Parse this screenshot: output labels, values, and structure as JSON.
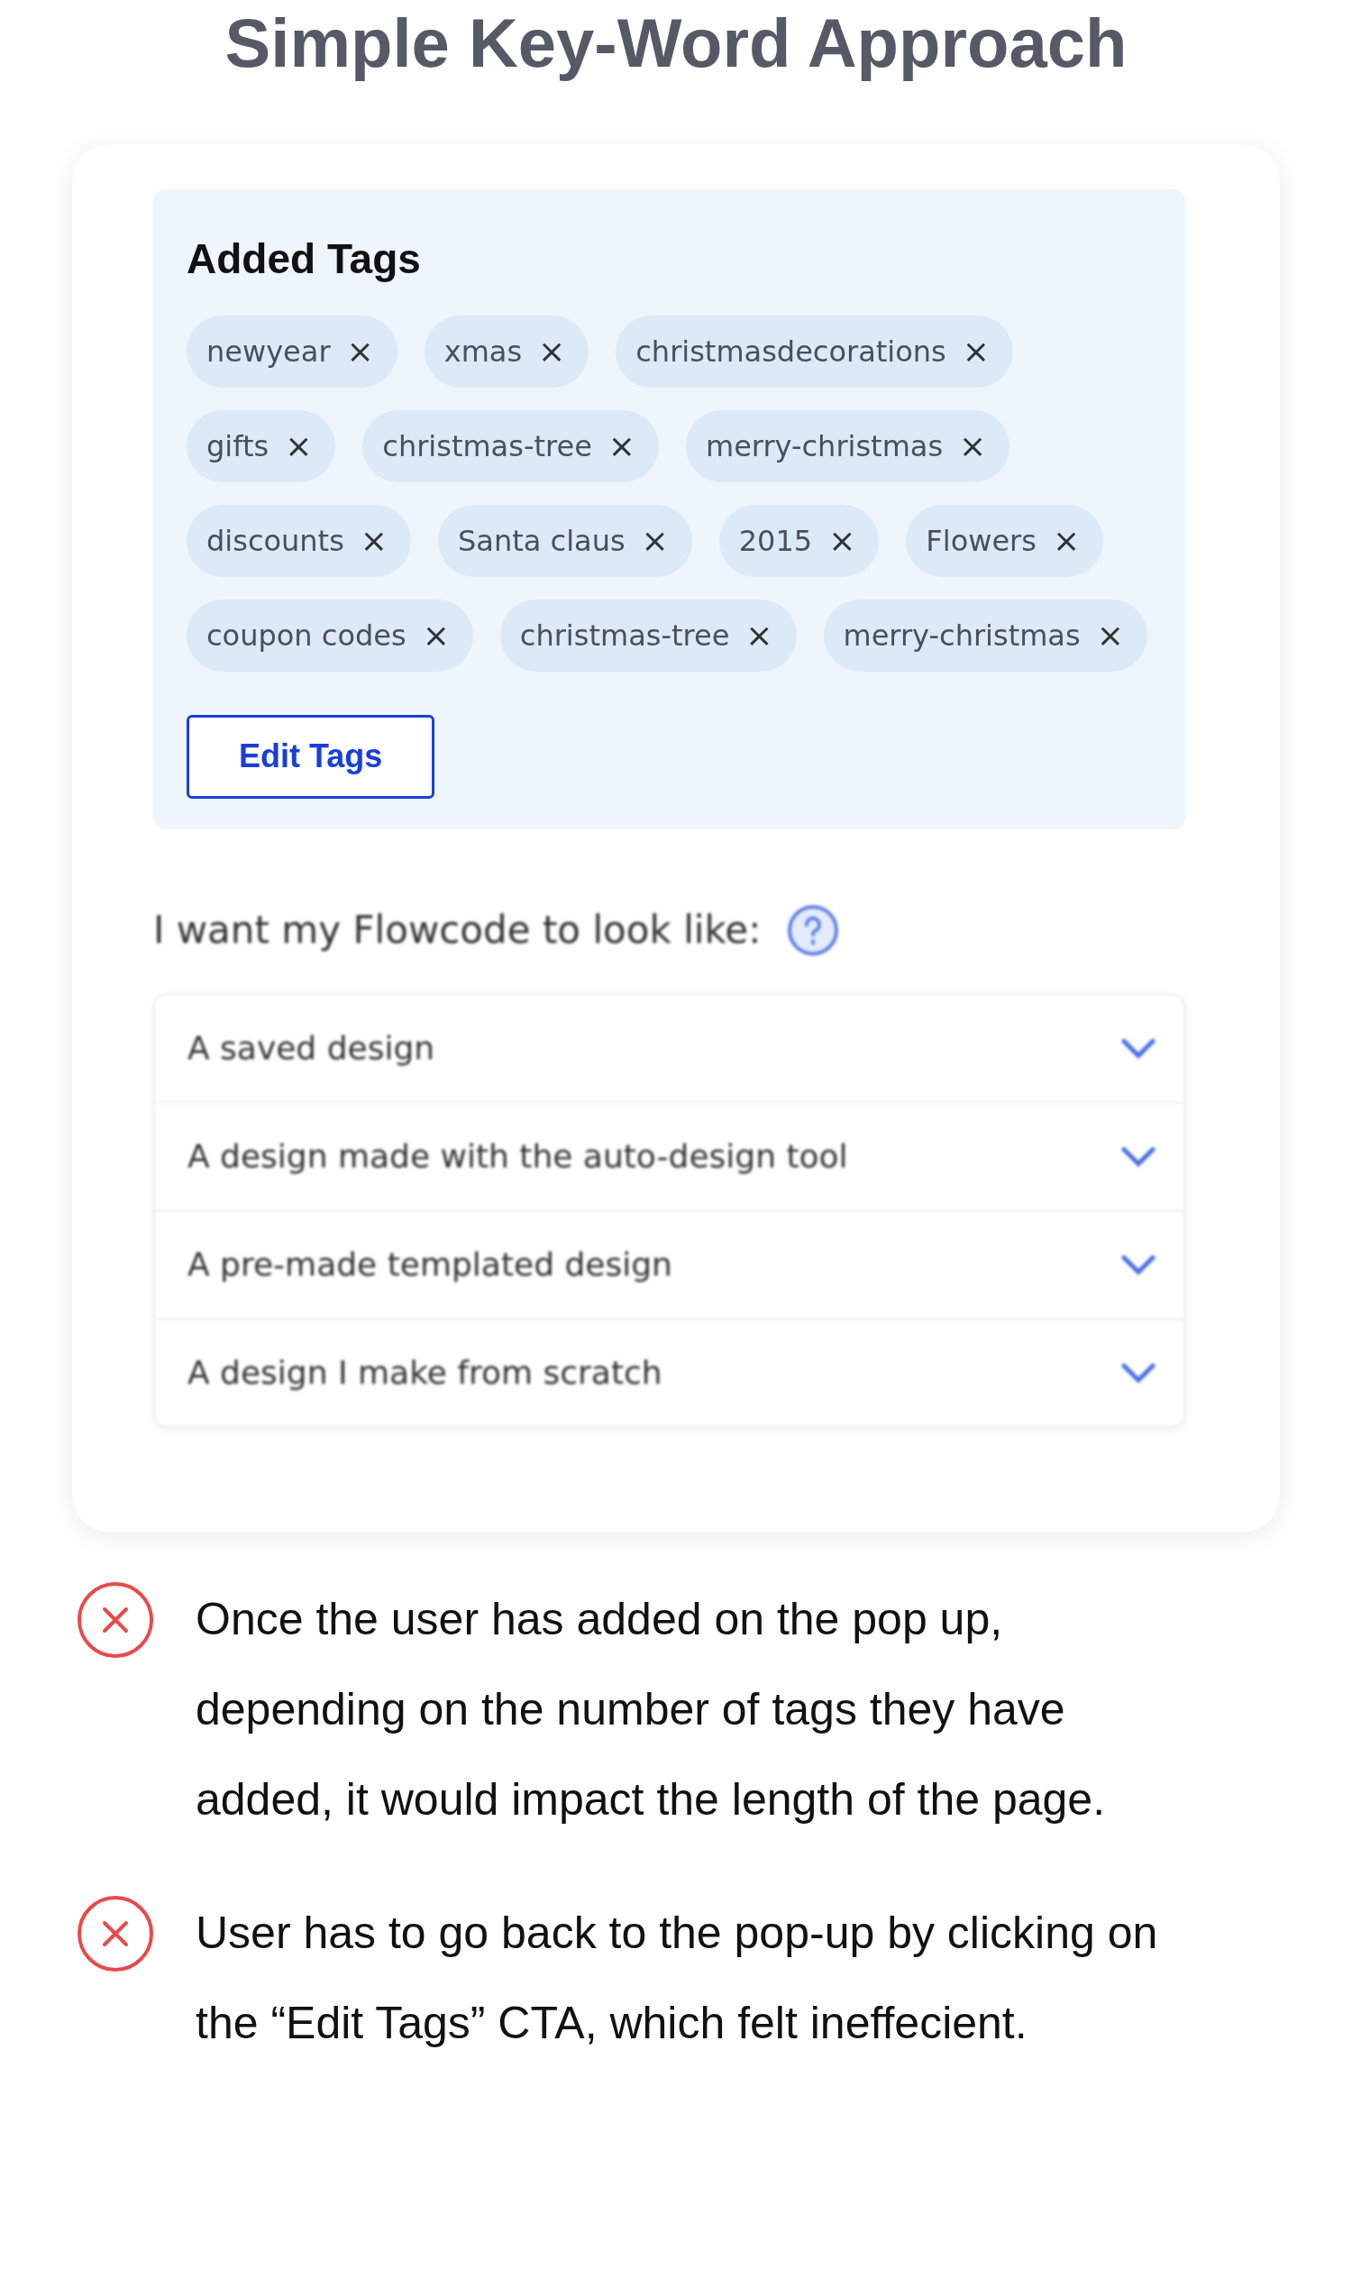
{
  "title": "Simple Key-Word Approach",
  "tags_panel": {
    "heading": "Added Tags",
    "tags": [
      {
        "label": "newyear",
        "remove": "×"
      },
      {
        "label": "xmas",
        "remove": "×"
      },
      {
        "label": "christmasdecorations",
        "remove": "×"
      },
      {
        "label": "gifts",
        "remove": "×"
      },
      {
        "label": "christmas-tree",
        "remove": "×"
      },
      {
        "label": "merry-christmas",
        "remove": "×"
      },
      {
        "label": "discounts",
        "remove": "×"
      },
      {
        "label": "Santa claus",
        "remove": "×"
      },
      {
        "label": "2015",
        "remove": "×"
      },
      {
        "label": "Flowers",
        "remove": "×"
      },
      {
        "label": "coupon codes",
        "remove": "×"
      },
      {
        "label": "christmas-tree",
        "remove": "×"
      },
      {
        "label": "merry-christmas",
        "remove": "×"
      }
    ],
    "edit_button": "Edit Tags"
  },
  "question": {
    "label": "I want my Flowcode to look like:",
    "options": [
      "A saved design",
      "A design made with the auto-design tool",
      "A pre-made templated design",
      "A design I make from scratch"
    ]
  },
  "notes": [
    "Once the user has added on the pop up, depending on the number of tags they have added, it would impact the length of the page.",
    "User has to go back to the pop-up by clicking on the “Edit Tags” CTA, which felt ineffecient."
  ]
}
